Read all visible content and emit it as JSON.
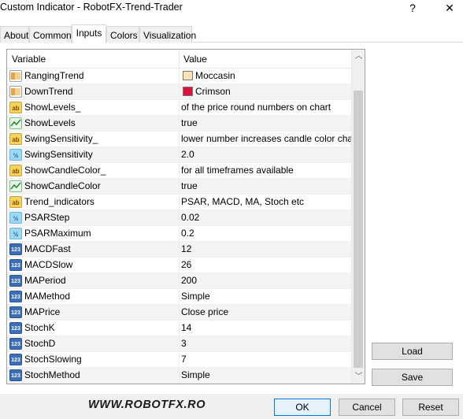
{
  "window": {
    "title": "Custom Indicator - RobotFX-Trend-Trader",
    "help_label": "?",
    "close_label": "✕"
  },
  "tabs": [
    {
      "label": "About"
    },
    {
      "label": "Common"
    },
    {
      "label": "Inputs"
    },
    {
      "label": "Colors"
    },
    {
      "label": "Visualization"
    }
  ],
  "grid": {
    "headers": {
      "variable": "Variable",
      "value": "Value"
    },
    "rows": [
      {
        "icon": "color-icon",
        "variable": "RangingTrend",
        "value": "Moccasin",
        "swatch": "#FFE4B5"
      },
      {
        "icon": "color-icon",
        "variable": "DownTrend",
        "value": "Crimson",
        "swatch": "#DC143C"
      },
      {
        "icon": "string-icon",
        "variable": "ShowLevels_",
        "value": "of the price round numbers on chart"
      },
      {
        "icon": "bool-icon",
        "variable": "ShowLevels",
        "value": "true"
      },
      {
        "icon": "string-icon",
        "variable": "SwingSensitivity_",
        "value": "lower number increases candle color chan..."
      },
      {
        "icon": "double-icon",
        "variable": "SwingSensitivity",
        "value": "2.0"
      },
      {
        "icon": "string-icon",
        "variable": "ShowCandleColor_",
        "value": "for all timeframes available"
      },
      {
        "icon": "bool-icon",
        "variable": "ShowCandleColor",
        "value": "true"
      },
      {
        "icon": "string-icon",
        "variable": "Trend_indicators",
        "value": "PSAR, MACD, MA, Stoch etc"
      },
      {
        "icon": "double-icon",
        "variable": "PSARStep",
        "value": "0.02"
      },
      {
        "icon": "double-icon",
        "variable": "PSARMaximum",
        "value": "0.2"
      },
      {
        "icon": "int-icon",
        "variable": "MACDFast",
        "value": "12"
      },
      {
        "icon": "int-icon",
        "variable": "MACDSlow",
        "value": "26"
      },
      {
        "icon": "int-icon",
        "variable": "MAPeriod",
        "value": "200"
      },
      {
        "icon": "int-icon",
        "variable": "MAMethod",
        "value": "Simple"
      },
      {
        "icon": "int-icon",
        "variable": "MAPrice",
        "value": "Close price"
      },
      {
        "icon": "int-icon",
        "variable": "StochK",
        "value": "14"
      },
      {
        "icon": "int-icon",
        "variable": "StochD",
        "value": "3"
      },
      {
        "icon": "int-icon",
        "variable": "StochSlowing",
        "value": "7"
      },
      {
        "icon": "int-icon",
        "variable": "StochMethod",
        "value": "Simple"
      }
    ]
  },
  "icon_glyphs": {
    "string": "ab",
    "int": "123",
    "double": "½"
  },
  "side_buttons": {
    "load": "Load",
    "save": "Save"
  },
  "footer": {
    "brand": "WWW.ROBOTFX.RO",
    "ok": "OK",
    "cancel": "Cancel",
    "reset": "Reset"
  }
}
